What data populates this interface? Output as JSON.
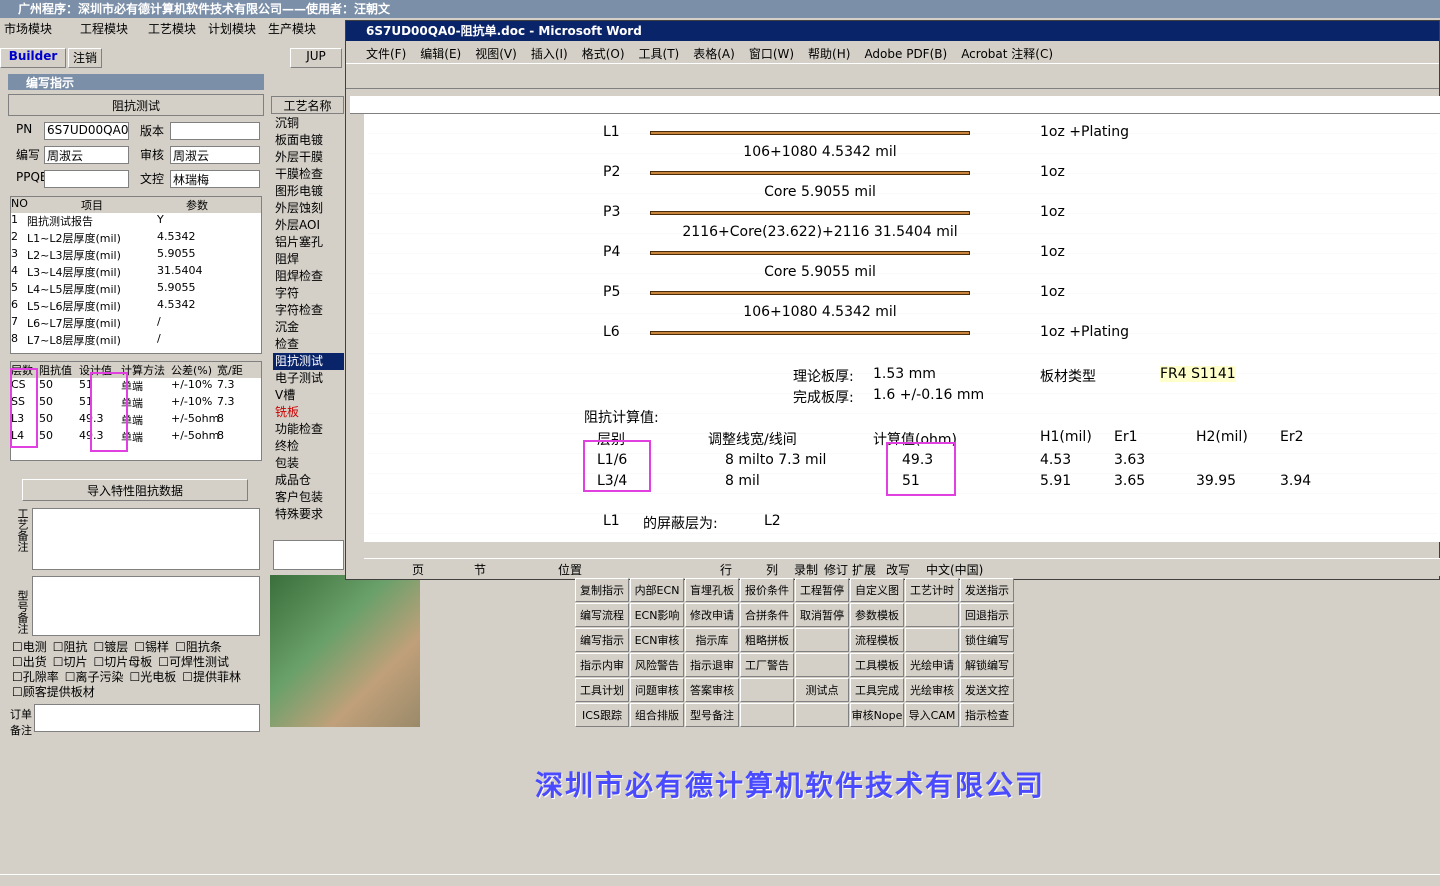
{
  "title": "广州程序：深圳市必有德计算机软件技术有限公司——使用者：汪朝文",
  "modules": [
    "市场模块",
    "工程模块",
    "工艺模块",
    "计划模块",
    "生产模块"
  ],
  "word_title": "6S7UD00QA0-阻抗单.doc - Microsoft Word",
  "word_menu": [
    "文件(F)",
    "编辑(E)",
    "视图(V)",
    "插入(I)",
    "格式(O)",
    "工具(T)",
    "表格(A)",
    "窗口(W)",
    "帮助(H)",
    "Adobe PDF(B)",
    "Acrobat 注释(C)"
  ],
  "company": "深圳市必有德计算机软件技术有限公司",
  "left": {
    "builder": "Builder",
    "logout": "注销",
    "jup": "JUP",
    "title": "编写指示",
    "section": "阻抗测试",
    "pn_label": "PN",
    "pn_value": "6S7UD00QA0",
    "version_label": "版本",
    "editor_label": "编写",
    "editor_value": "周淑云",
    "review_label": "审核",
    "review_value": "周淑云",
    "ppqe_label": "PPQE",
    "control_label": "文控",
    "control_value": "林瑞梅",
    "table_headers": [
      "NO",
      "项目",
      "参数"
    ],
    "rows": [
      [
        "1",
        "阻抗测试报告",
        "Y"
      ],
      [
        "2",
        "L1~L2层厚度(mil)",
        "4.5342"
      ],
      [
        "3",
        "L2~L3层厚度(mil)",
        "5.9055"
      ],
      [
        "4",
        "L3~L4层厚度(mil)",
        "31.5404"
      ],
      [
        "5",
        "L4~L5层厚度(mil)",
        "5.9055"
      ],
      [
        "6",
        "L5~L6层厚度(mil)",
        "4.5342"
      ],
      [
        "7",
        "L6~L7层厚度(mil)",
        "/"
      ],
      [
        "8",
        "L7~L8层厚度(mil)",
        "/"
      ]
    ],
    "imp_headers": [
      "层数",
      "阻抗值",
      "设计值",
      "计算方法",
      "公差(%)",
      "宽/距"
    ],
    "imp_rows": [
      [
        "CS",
        "50",
        "51",
        "单端",
        "+/-10%",
        "7.3"
      ],
      [
        "SS",
        "50",
        "51",
        "单端",
        "+/-10%",
        "7.3"
      ],
      [
        "L3",
        "50",
        "49.3",
        "单端",
        "+/-5ohm",
        "8"
      ],
      [
        "L4",
        "50",
        "49.3",
        "单端",
        "+/-5ohm",
        "8"
      ]
    ],
    "import_btn": "导入特性阻抗数据",
    "process_note": "工艺备注",
    "model_note": "型号备注",
    "order_note": "订单备注",
    "checks": [
      [
        "电测",
        "阻抗",
        "镀层",
        "锡样",
        "阻抗条"
      ],
      [
        "出货",
        "切片",
        "切片母板",
        "可焊性测试"
      ],
      [
        "孔隙率",
        "离子污染",
        "光电板",
        "提供菲林"
      ],
      [
        "顾客提供板材"
      ]
    ]
  },
  "process": {
    "header": "工艺名称",
    "items": [
      "沉铜",
      "板面电镀",
      "外层干膜",
      "干膜检查",
      "图形电镀",
      "外层蚀刻",
      "外层AOI",
      "铝片塞孔",
      "阻焊",
      "阻焊检查",
      "字符",
      "字符检查",
      "沉金",
      "检查",
      "阻抗测试",
      "电子测试",
      "V槽",
      "铣板",
      "功能检查",
      "终检",
      "包装",
      "成品仓",
      "客户包装",
      "特殊要求"
    ]
  },
  "doc": {
    "layers": [
      "L1",
      "P2",
      "P3",
      "P4",
      "P5",
      "L6"
    ],
    "copper": [
      "1oz +Plating",
      "1oz",
      "1oz",
      "1oz",
      "1oz",
      "1oz +Plating"
    ],
    "dielectrics": [
      "106+1080    4.5342 mil",
      "Core    5.9055 mil",
      "2116+Core(23.622)+2116    31.5404 mil",
      "Core    5.9055 mil",
      "106+1080    4.5342 mil"
    ],
    "theory_label": "理论板厚:",
    "theory_value": "1.53 mm",
    "finish_label": "完成板厚:",
    "finish_value": "1.6 +/-0.16 mm",
    "material_label": "板材类型",
    "material_value": "FR4 S1141",
    "calc_label": "阻抗计算值:",
    "calc_headers": [
      "层别",
      "调整线宽/线间",
      "计算值(ohm)",
      "H1(mil)",
      "Er1",
      "H2(mil)",
      "Er2"
    ],
    "calc_rows": [
      [
        "L1/6",
        "8 milto 7.3 mil",
        "49.3",
        "4.53",
        "3.63",
        "",
        ""
      ],
      [
        "L3/4",
        "8 mil",
        "51",
        "5.91",
        "3.65",
        "39.95",
        "3.94"
      ]
    ],
    "shield1": [
      "L1",
      "的屏蔽层为:",
      "L2"
    ]
  },
  "statusbar": [
    "页",
    "节",
    "位置",
    "行",
    "列",
    "录制",
    "修订",
    "扩展",
    "改写",
    "中文(中国)"
  ],
  "actions": [
    [
      "复制指示",
      "内部ECN",
      "盲埋孔板",
      "报价条件",
      "工程暂停",
      "自定义图",
      "工艺计时",
      "发送指示"
    ],
    [
      "编写流程",
      "ECN影响",
      "修改申请",
      "合拼条件",
      "取消暂停",
      "参数模板",
      "",
      "回退指示"
    ],
    [
      "编写指示",
      "ECN审核",
      "指示库",
      "粗略拼板",
      "",
      "流程模板",
      "",
      "锁住编写"
    ],
    [
      "指示内审",
      "风险警告",
      "指示退审",
      "工厂警告",
      "",
      "工具模板",
      "光绘申请",
      "解锁编写"
    ],
    [
      "工具计划",
      "问题审核",
      "答案审核",
      "",
      "测试点",
      "工具完成",
      "光绘审核",
      "发送文控"
    ],
    [
      "ICS跟踪",
      "组合排版",
      "型号备注",
      "",
      "",
      "审核Nope",
      "导入CAM",
      "指示检查"
    ]
  ]
}
